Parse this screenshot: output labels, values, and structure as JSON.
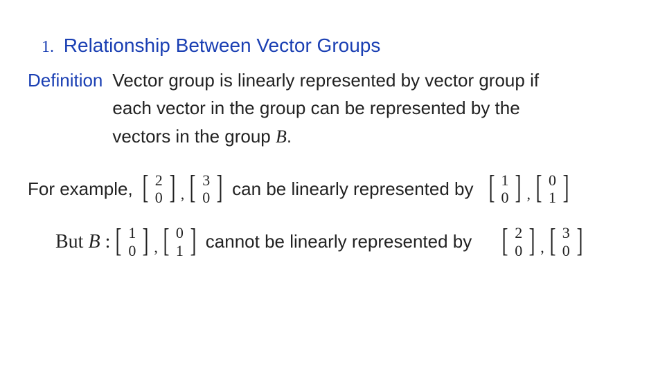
{
  "title": {
    "number": "1.",
    "text": "Relationship Between Vector Groups"
  },
  "definition": {
    "label": "Definition",
    "body_line1": "Vector group  is linearly represented by vector group  if",
    "body_line2": "each vector in the group  can be represented by the",
    "body_line3_prefix": "vectors in the group ",
    "body_line3_symbol": "B",
    "body_line3_suffix": "."
  },
  "example": {
    "lead": "For example,",
    "pairA": {
      "v1": [
        "2",
        "0"
      ],
      "v2": [
        "3",
        "0"
      ]
    },
    "mid": "can be linearly represented by",
    "pairB": {
      "v1": [
        "1",
        "0"
      ],
      "v2": [
        "0",
        "1"
      ]
    }
  },
  "counter": {
    "lead_prefix": "But ",
    "lead_symbol": "B",
    "lead_colon": " :",
    "pairB": {
      "v1": [
        "1",
        "0"
      ],
      "v2": [
        "0",
        "1"
      ]
    },
    "mid": "cannot be linearly represented by",
    "pairA": {
      "v1": [
        "2",
        "0"
      ],
      "v2": [
        "3",
        "0"
      ]
    }
  },
  "glyphs": {
    "comma": ","
  }
}
